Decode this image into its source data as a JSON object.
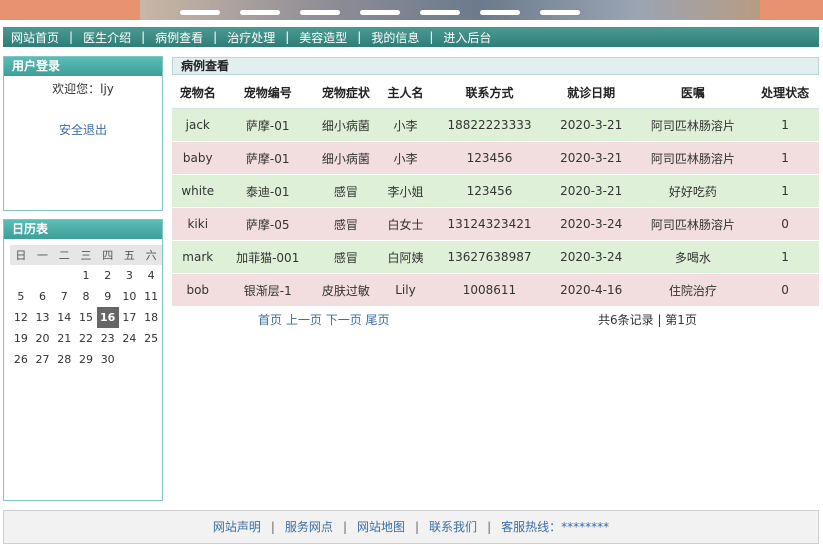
{
  "nav": {
    "items": [
      "网站首页",
      "医生介绍",
      "病例查看",
      "治疗处理",
      "美容造型",
      "我的信息",
      "进入后台"
    ]
  },
  "login": {
    "title": "用户登录",
    "welcome": "欢迎您：ljy",
    "logout": "安全退出"
  },
  "calendar": {
    "title": "日历表",
    "weekdays": [
      "日",
      "一",
      "二",
      "三",
      "四",
      "五",
      "六"
    ],
    "weeks": [
      [
        "",
        "",
        "",
        "1",
        "2",
        "3",
        "4"
      ],
      [
        "5",
        "6",
        "7",
        "8",
        "9",
        "10",
        "11"
      ],
      [
        "12",
        "13",
        "14",
        "15",
        "16",
        "17",
        "18"
      ],
      [
        "19",
        "20",
        "21",
        "22",
        "23",
        "24",
        "25"
      ],
      [
        "26",
        "27",
        "28",
        "29",
        "30",
        "",
        ""
      ]
    ],
    "today": "16"
  },
  "records": {
    "title": "病例查看",
    "columns": [
      "宠物名",
      "宠物编号",
      "宠物症状",
      "主人名",
      "联系方式",
      "就诊日期",
      "医嘱",
      "处理状态"
    ],
    "rows": [
      [
        "jack",
        "萨摩-01",
        "细小病菌",
        "小李",
        "18822223333",
        "2020-3-21",
        "阿司匹林肠溶片",
        "1"
      ],
      [
        "baby",
        "萨摩-01",
        "细小病菌",
        "小李",
        "123456",
        "2020-3-21",
        "阿司匹林肠溶片",
        "1"
      ],
      [
        "white",
        "泰迪-01",
        "感冒",
        "李小姐",
        "123456",
        "2020-3-21",
        "好好吃药",
        "1"
      ],
      [
        "kiki",
        "萨摩-05",
        "感冒",
        "白女士",
        "13124323421",
        "2020-3-24",
        "阿司匹林肠溶片",
        "0"
      ],
      [
        "mark",
        "加菲猫-001",
        "感冒",
        "白阿姨",
        "13627638987",
        "2020-3-24",
        "多喝水",
        "1"
      ],
      [
        "bob",
        "银渐层-1",
        "皮肤过敏",
        "Lily",
        "1008611",
        "2020-4-16",
        "住院治疗",
        "0"
      ]
    ]
  },
  "pager": {
    "first": "首页",
    "prev": "上一页",
    "next": "下一页",
    "last": "尾页",
    "summary": "共6条记录 | 第1页"
  },
  "footer": {
    "links": [
      "网站声明",
      "服务网点",
      "网站地图",
      "联系我们"
    ],
    "hotline": "客服热线：********"
  },
  "colors": {
    "nav_bg": "#2f7d77",
    "row_green": "#dff0d8",
    "row_pink": "#f2dede",
    "link": "#3b6ea5"
  }
}
